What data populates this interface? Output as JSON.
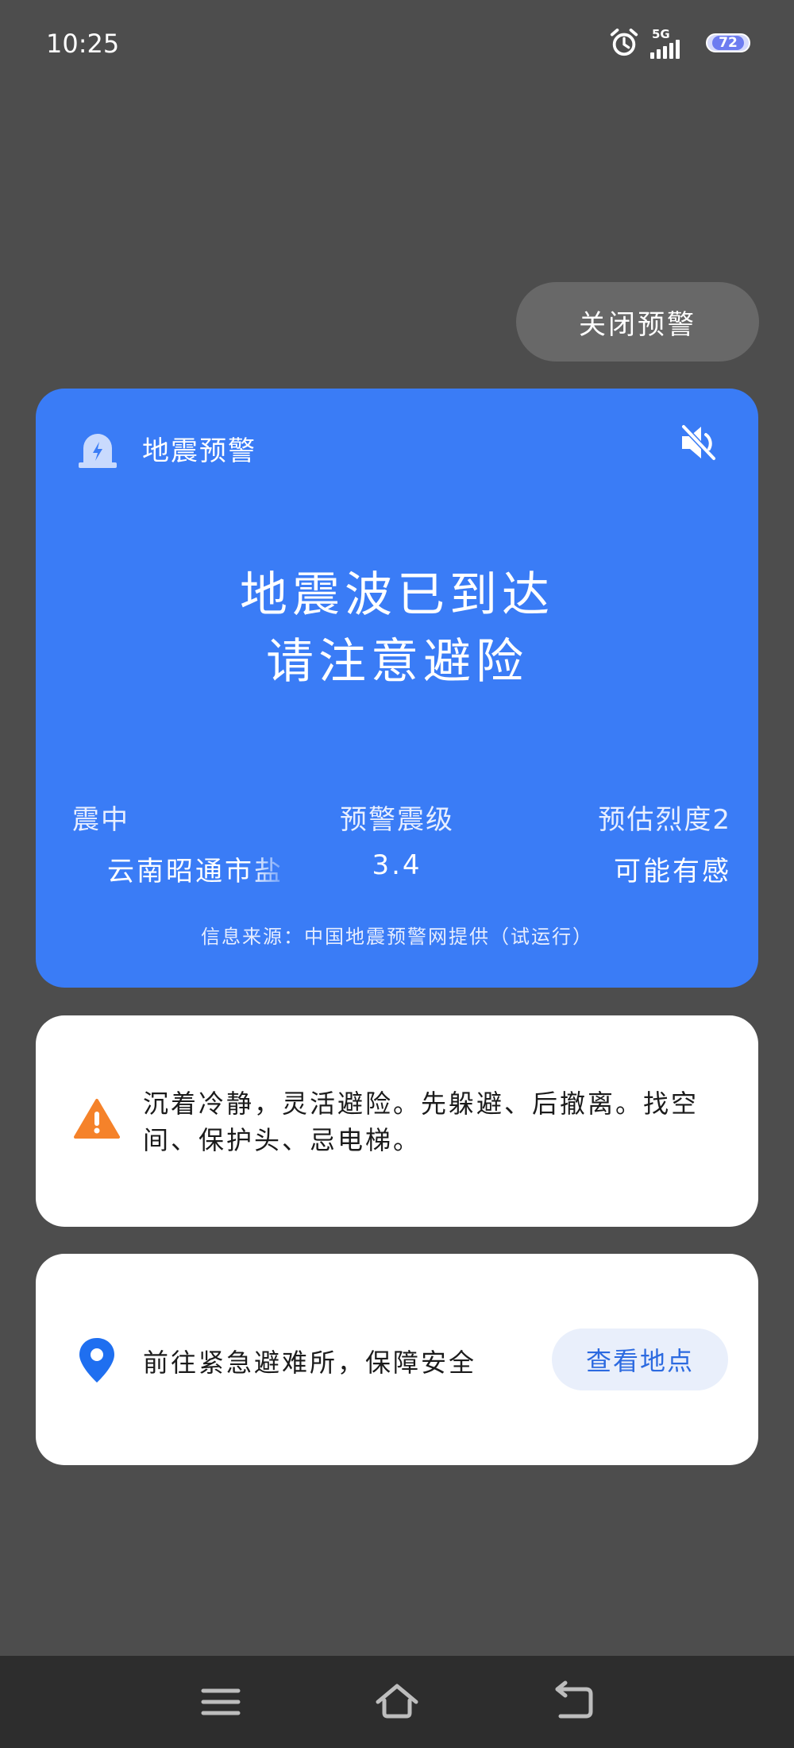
{
  "status_bar": {
    "time": "10:25",
    "network": "5G",
    "battery": "72",
    "icons": [
      "alarm-clock-icon",
      "signal-icon",
      "battery-icon"
    ]
  },
  "close_button": {
    "label": "关闭预警"
  },
  "alert": {
    "header_label": "地震预警",
    "line1": "地震波已到达",
    "line2": "请注意避险",
    "stats": {
      "epicenter": {
        "label": "震中",
        "value": "云南昭通市盐"
      },
      "magnitude": {
        "label": "预警震级",
        "value": "3.4"
      },
      "intensity": {
        "label": "预估烈度2",
        "value": "可能有感"
      }
    },
    "source": "信息来源：中国地震预警网提供（试运行）",
    "colors": {
      "card": "#3a7cf6"
    }
  },
  "tip": {
    "text": "沉着冷静，灵活避险。先躲避、后撤离。找空间、保护头、忌电梯。",
    "icon": "warning-triangle-icon",
    "icon_color": "#f5822a"
  },
  "shelter": {
    "text": "前往紧急避难所，保障安全",
    "button": "查看地点",
    "icon": "location-pin-icon",
    "icon_color": "#1f6ff0"
  },
  "nav": {
    "icons": [
      "menu-icon",
      "home-icon",
      "back-icon"
    ]
  }
}
